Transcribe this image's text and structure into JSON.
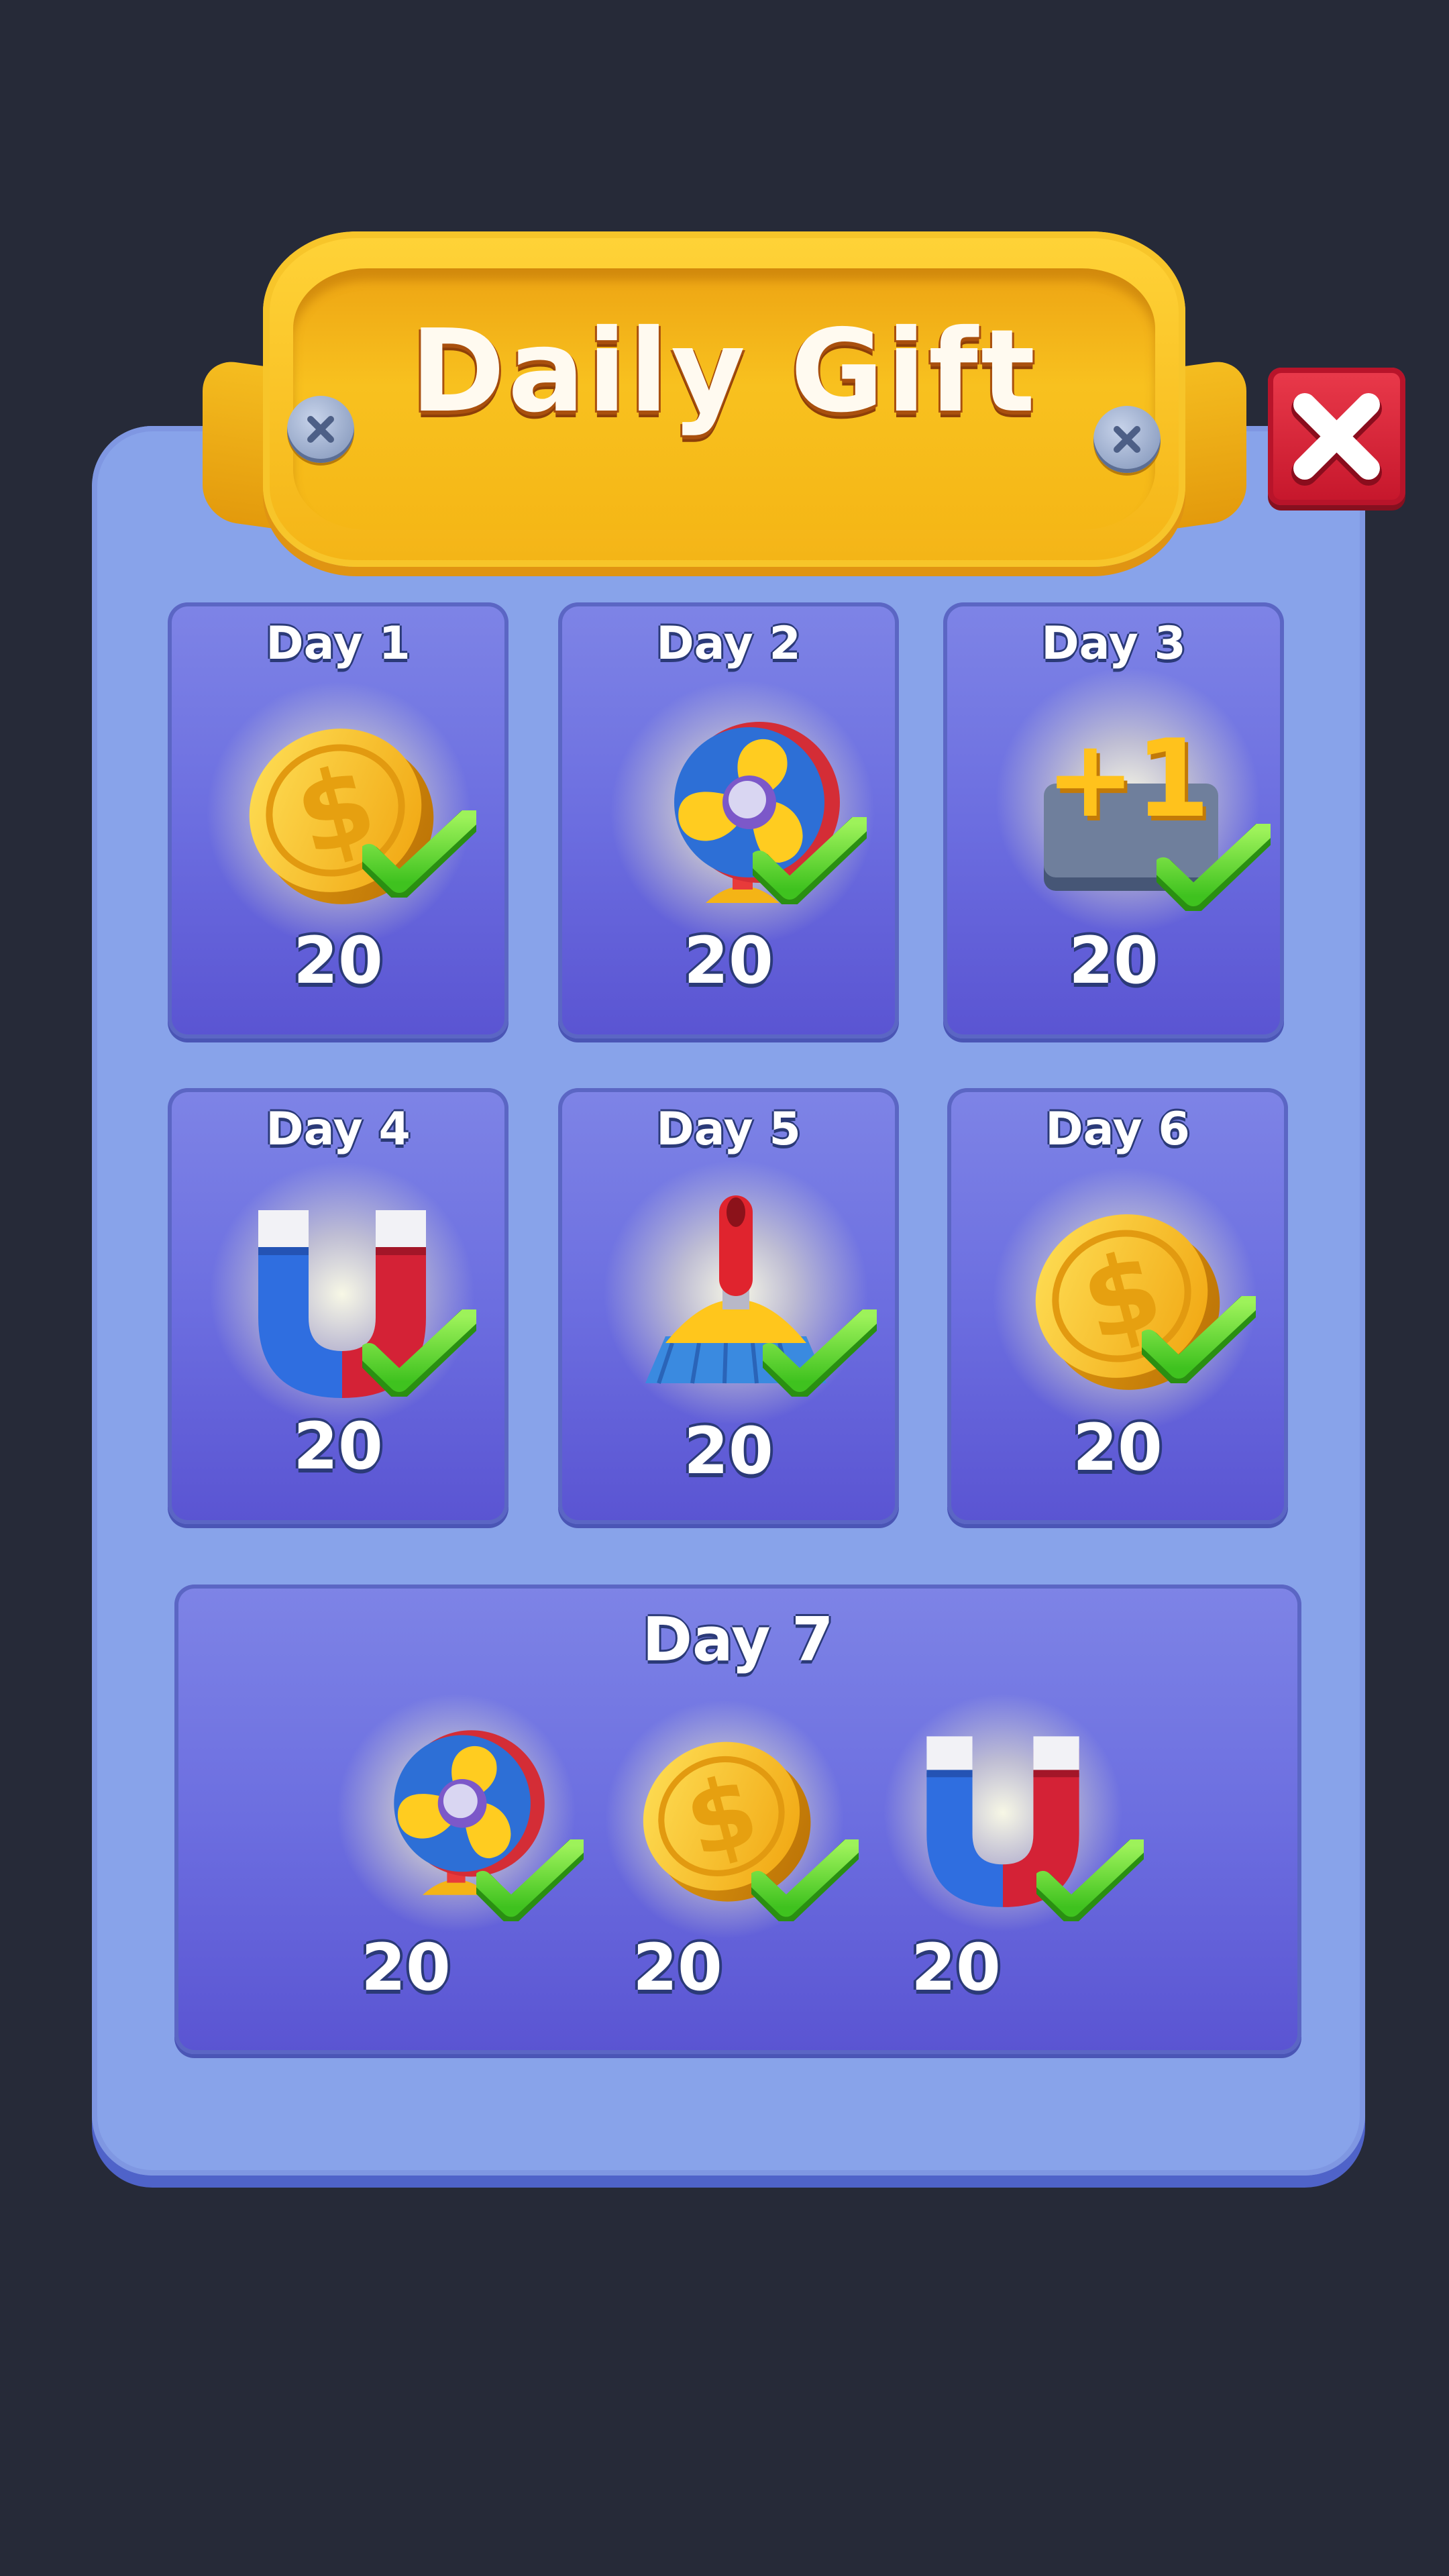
{
  "title": "Daily Gift",
  "close_icon": "close-x-icon",
  "colors": {
    "background": "#262a38",
    "panel": "#88a3ea",
    "banner": "#f7b91b",
    "card": "#6c6ee0",
    "close_button": "#d8283c",
    "check": "#5ee03a"
  },
  "days": [
    {
      "label": "Day 1",
      "reward_icon": "coin-icon",
      "amount": "20",
      "claimed": true
    },
    {
      "label": "Day 2",
      "reward_icon": "fan-icon",
      "amount": "20",
      "claimed": true
    },
    {
      "label": "Day 3",
      "reward_icon": "plus-one-icon",
      "amount": "20",
      "claimed": true
    },
    {
      "label": "Day 4",
      "reward_icon": "magnet-icon",
      "amount": "20",
      "claimed": true
    },
    {
      "label": "Day 5",
      "reward_icon": "broom-icon",
      "amount": "20",
      "claimed": true
    },
    {
      "label": "Day 6",
      "reward_icon": "coin-icon",
      "amount": "20",
      "claimed": true
    }
  ],
  "day7": {
    "label": "Day 7",
    "rewards": [
      {
        "reward_icon": "fan-icon",
        "amount": "20",
        "claimed": true
      },
      {
        "reward_icon": "coin-icon",
        "amount": "20",
        "claimed": true
      },
      {
        "reward_icon": "magnet-icon",
        "amount": "20",
        "claimed": true
      }
    ]
  }
}
